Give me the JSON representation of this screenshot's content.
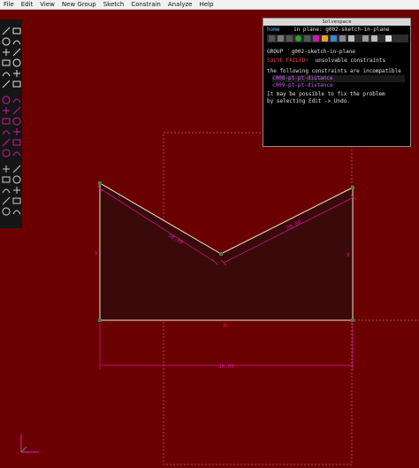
{
  "menu": [
    "File",
    "Edit",
    "View",
    "New Group",
    "Sketch",
    "Constrain",
    "Analyze",
    "Help"
  ],
  "text_window": {
    "title": "Solvespace",
    "nav_home": "home",
    "nav_sep": " ",
    "nav_in_plane": "in plane:",
    "nav_group": "g002-sketch-in-plane",
    "group_label": "GROUP",
    "group_name": "g002-sketch-in-plane",
    "solve_label": "SOLVE FAILED!",
    "solve_msg": "unsolvable constraints",
    "incompatible": "the following constraints are incompatible",
    "constraint_1": "c008-pt-pt-distance",
    "constraint_2": "c009-pt-pt-distance",
    "hint_1": "It may be possible to fix the problem",
    "hint_2": "by selecting Edit -> Undo."
  },
  "dimensions": {
    "left_diag": "50.00",
    "right_diag": "20.00",
    "bottom": "50.00"
  },
  "constraint_marks": {
    "left_v": "V",
    "right_v": "V",
    "bottom_h": "H"
  },
  "toolbar_icons": [
    "line-icon",
    "rectangle-icon",
    "circle-icon",
    "arc-icon",
    "cubic-icon",
    "datum-point-icon",
    "text-icon",
    "image-icon",
    "construction-icon",
    "split-icon",
    "tangent-arc-icon",
    "nearest-icon",
    "distance-icon",
    "angle-icon",
    "horizontal-icon",
    "vertical-icon",
    "parallel-icon",
    "perpendicular-icon",
    "on-point-icon",
    "equal-icon",
    "symmetric-icon",
    "midpoint-icon",
    "ref-icon",
    "step-rotate-icon",
    "step-translate-icon",
    "extrude-icon",
    "revolve-icon",
    "helix-icon",
    "lathe-icon",
    "workplane-icon",
    "assemble-icon",
    "sketch-in-3d-icon",
    "nearest-iso-icon",
    "nearest-ortho-icon"
  ],
  "colors": {
    "background": "#6b0000",
    "sketch_line": "#f2e8c8",
    "constraint": "#d0189a",
    "fill": "#3a0a0a"
  }
}
